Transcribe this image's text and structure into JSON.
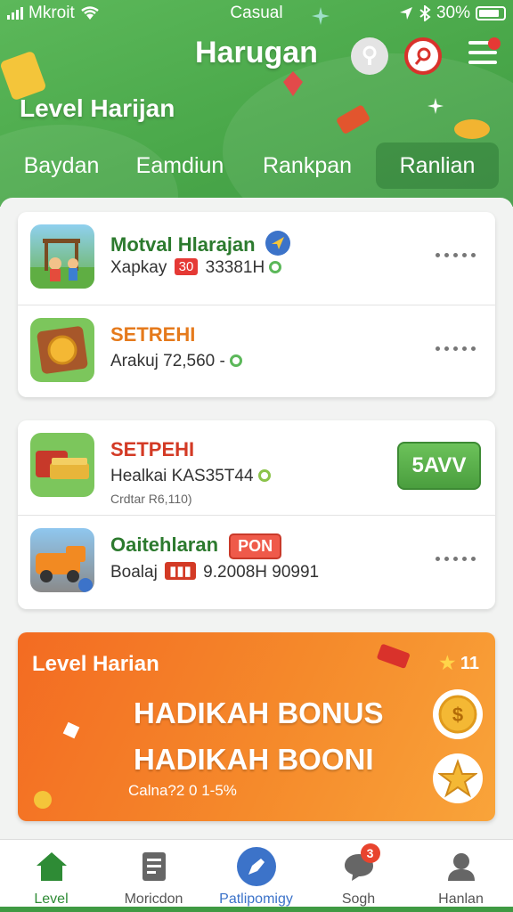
{
  "status_bar": {
    "carrier": "Mkroit",
    "center": "Casual",
    "battery": "30%"
  },
  "header": {
    "title": "Harugan",
    "subtitle": "Level Harijan",
    "tabs": [
      {
        "label": "Baydan",
        "active": false
      },
      {
        "label": "Eamdiun",
        "active": false
      },
      {
        "label": "Rankpan",
        "active": false
      },
      {
        "label": "Ranlian",
        "active": true
      }
    ]
  },
  "list_card_1": {
    "rows": [
      {
        "title": "Motval Hlarajan",
        "line_pre": "Xapkay",
        "tag": "30",
        "line_post": "33381H",
        "icon": "playground-icon",
        "verified_icon": "verified-badge-icon"
      },
      {
        "title": "SETREHI",
        "line": "Arakuj 72,560 -",
        "icon": "coin-frame-icon"
      }
    ]
  },
  "list_card_2": {
    "rows": [
      {
        "title": "SETPEHI",
        "line": "Healkai KAS35T44",
        "sub": "Crdtar R6,110)",
        "action_label": "5AVV",
        "icon": "cash-stack-icon"
      },
      {
        "title": "Oaitehlaran",
        "pill": "PON",
        "line_pre": "Boalaj",
        "line_post": "9.2008H 90991",
        "icon": "delivery-truck-icon"
      }
    ]
  },
  "banner": {
    "head": "Level Harian",
    "count": "11",
    "line1": "HADIKAH BONUS",
    "line2": "HADIKAH BOONI",
    "footer": "Calna?2 0 1-5%"
  },
  "bottom_nav": [
    {
      "label": "Level",
      "icon": "home-icon",
      "active": true,
      "color": "#2e8b35"
    },
    {
      "label": "Moricdon",
      "icon": "document-icon",
      "active": false,
      "color": "#555555"
    },
    {
      "label": "Patlipomigy",
      "icon": "pen-icon",
      "active": false,
      "color": "#3c73c9"
    },
    {
      "label": "Sogh",
      "icon": "chat-icon",
      "active": false,
      "badge": "3",
      "color": "#555555"
    },
    {
      "label": "Hanlan",
      "icon": "profile-icon",
      "active": false,
      "color": "#555555"
    }
  ],
  "colors": {
    "brand_green": "#4aa84a",
    "banner_orange": "#f58a2b",
    "badge_red": "#e53935"
  }
}
